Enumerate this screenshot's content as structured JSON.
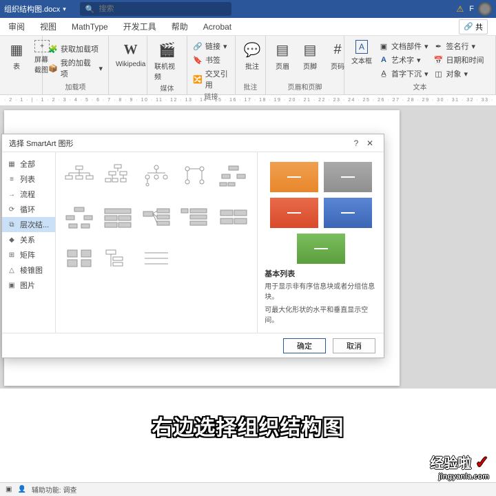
{
  "titlebar": {
    "filename": "组织结构图.docx",
    "search_placeholder": "搜索",
    "user_initial": "F"
  },
  "tabs": {
    "items": [
      "审阅",
      "视图",
      "MathType",
      "开发工具",
      "帮助",
      "Acrobat"
    ],
    "share": "共"
  },
  "ribbon": {
    "group1": {
      "biao": "表",
      "screenshot": "屏幕截图"
    },
    "addins": {
      "get": "获取加载项",
      "my": "我的加载项",
      "label": "加载项"
    },
    "wiki": {
      "name": "Wikipedia"
    },
    "media": {
      "onlinevideo": "联机视频",
      "label": "媒体"
    },
    "links": {
      "link": "链接",
      "bookmark": "书签",
      "crossref": "交叉引用",
      "label": "链接"
    },
    "comments": {
      "comment": "批注",
      "label": "批注"
    },
    "headerfooter": {
      "header": "页眉",
      "footer": "页脚",
      "pagenum": "页码",
      "label": "页眉和页脚"
    },
    "text": {
      "textbox": "文本框",
      "parts": "文档部件",
      "wordart": "艺术字",
      "dropcap": "首字下沉",
      "signature": "签名行",
      "datetime": "日期和时间",
      "object": "对象",
      "label": "文本"
    }
  },
  "dialog": {
    "title": "选择 SmartArt 图形",
    "help": "?",
    "categories": [
      "全部",
      "列表",
      "流程",
      "循环",
      "层次结...",
      "关系",
      "矩阵",
      "棱锥图",
      "图片"
    ],
    "preview": {
      "title": "基本列表",
      "desc1": "用于显示非有序信息块或者分组信息块。",
      "desc2": "可最大化形状的水平和垂直显示空间。",
      "colors": [
        "#e8862a",
        "#8f8f8f",
        "#d84a2a",
        "#3a66b5",
        "#5a9e3e"
      ]
    },
    "ok": "确定",
    "cancel": "取消"
  },
  "caption": "右边选择组织结构图",
  "watermark": {
    "brand": "经验啦",
    "url": "jingyanla.com"
  },
  "statusbar": {
    "accessibility": "辅助功能: 调查"
  }
}
